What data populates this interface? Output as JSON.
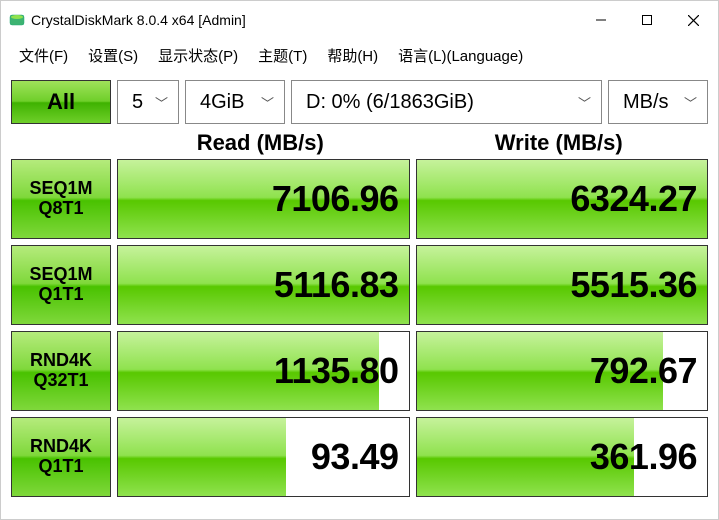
{
  "window": {
    "title": "CrystalDiskMark 8.0.4 x64 [Admin]"
  },
  "menu": {
    "file": "文件(F)",
    "settings": "设置(S)",
    "display": "显示状态(P)",
    "theme": "主题(T)",
    "help": "帮助(H)",
    "language": "语言(L)(Language)"
  },
  "toolbar": {
    "all_label": "All",
    "count": "5",
    "size": "4GiB",
    "drive": "D: 0% (6/1863GiB)",
    "unit": "MB/s"
  },
  "headers": {
    "read": "Read (MB/s)",
    "write": "Write (MB/s)"
  },
  "tests": [
    {
      "line1": "SEQ1M",
      "line2": "Q8T1",
      "read": "7106.96",
      "read_fill": 100,
      "write": "6324.27",
      "write_fill": 100
    },
    {
      "line1": "SEQ1M",
      "line2": "Q1T1",
      "read": "5116.83",
      "read_fill": 100,
      "write": "5515.36",
      "write_fill": 100
    },
    {
      "line1": "RND4K",
      "line2": "Q32T1",
      "read": "1135.80",
      "read_fill": 90,
      "write": "792.67",
      "write_fill": 85
    },
    {
      "line1": "RND4K",
      "line2": "Q1T1",
      "read": "93.49",
      "read_fill": 58,
      "write": "361.96",
      "write_fill": 75
    }
  ]
}
